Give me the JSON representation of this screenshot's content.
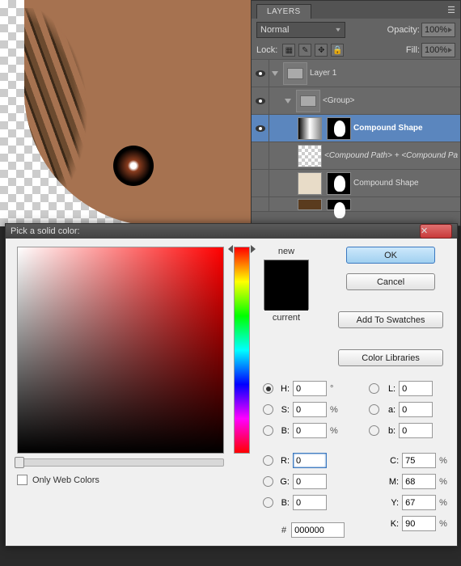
{
  "layers_panel": {
    "tab_label": "LAYERS",
    "blend_mode": "Normal",
    "opacity_label": "Opacity:",
    "opacity_value": "100%",
    "lock_label": "Lock:",
    "fill_label": "Fill:",
    "fill_value": "100%",
    "items": [
      {
        "name": "Layer 1",
        "type": "folder",
        "indent": 0
      },
      {
        "name": "<Group>",
        "type": "folder",
        "indent": 1
      },
      {
        "name": "Compound Shape",
        "type": "shape-grad",
        "indent": 2,
        "selected": true
      },
      {
        "name": "<Compound Path> + <Compound Pa",
        "type": "shape-checker",
        "indent": 2
      },
      {
        "name": "Compound Shape",
        "type": "shape-beige",
        "indent": 2
      },
      {
        "name": "",
        "type": "shape-brown",
        "indent": 2
      }
    ]
  },
  "color_picker": {
    "title": "Pick a solid color:",
    "new_label": "new",
    "current_label": "current",
    "ok": "OK",
    "cancel": "Cancel",
    "add_swatches": "Add To Swatches",
    "color_libraries": "Color Libraries",
    "web_only": "Only Web Colors",
    "hex_label": "#",
    "hex_value": "000000",
    "values": {
      "H": {
        "label": "H:",
        "value": "0",
        "unit": "°",
        "radio": true,
        "selected": true
      },
      "S": {
        "label": "S:",
        "value": "0",
        "unit": "%",
        "radio": true
      },
      "B": {
        "label": "B:",
        "value": "0",
        "unit": "%",
        "radio": true
      },
      "R": {
        "label": "R:",
        "value": "0",
        "unit": "",
        "radio": true,
        "focus": true
      },
      "G": {
        "label": "G:",
        "value": "0",
        "unit": "",
        "radio": true
      },
      "B2": {
        "label": "B:",
        "value": "0",
        "unit": "",
        "radio": true
      },
      "L": {
        "label": "L:",
        "value": "0",
        "unit": "",
        "radio": true
      },
      "a": {
        "label": "a:",
        "value": "0",
        "unit": "",
        "radio": true
      },
      "b": {
        "label": "b:",
        "value": "0",
        "unit": "",
        "radio": true
      },
      "C": {
        "label": "C:",
        "value": "75",
        "unit": "%"
      },
      "M": {
        "label": "M:",
        "value": "68",
        "unit": "%"
      },
      "Y": {
        "label": "Y:",
        "value": "67",
        "unit": "%"
      },
      "K": {
        "label": "K:",
        "value": "90",
        "unit": "%"
      }
    }
  }
}
